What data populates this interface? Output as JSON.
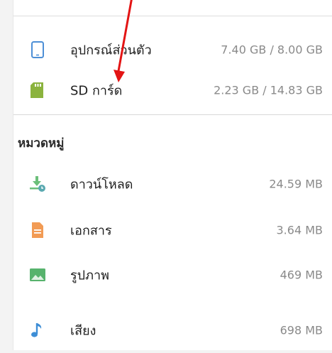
{
  "storage": [
    {
      "icon": "tablet-icon",
      "name": "อุปกรณ์ส่วนตัว",
      "size": "7.40 GB / 8.00 GB"
    },
    {
      "icon": "sd-card-icon",
      "name": "SD การ์ด",
      "size": "2.23 GB / 14.83 GB"
    }
  ],
  "categories_title": "หมวดหมู่",
  "categories": [
    {
      "icon": "download-icon",
      "name": "ดาวน์โหลด",
      "size": "24.59 MB"
    },
    {
      "icon": "document-icon",
      "name": "เอกสาร",
      "size": "3.64 MB"
    },
    {
      "icon": "image-icon",
      "name": "รูปภาพ",
      "size": "469 MB"
    },
    {
      "icon": "music-note-icon",
      "name": "เสียง",
      "size": "698 MB"
    }
  ],
  "colors": {
    "tablet": "#4d8fd6",
    "sd_card": "#8bb33e",
    "download": "#6cbf7a",
    "document": "#f29b54",
    "image": "#57b36d",
    "music": "#3e8ed6",
    "arrow": "#e31414"
  }
}
